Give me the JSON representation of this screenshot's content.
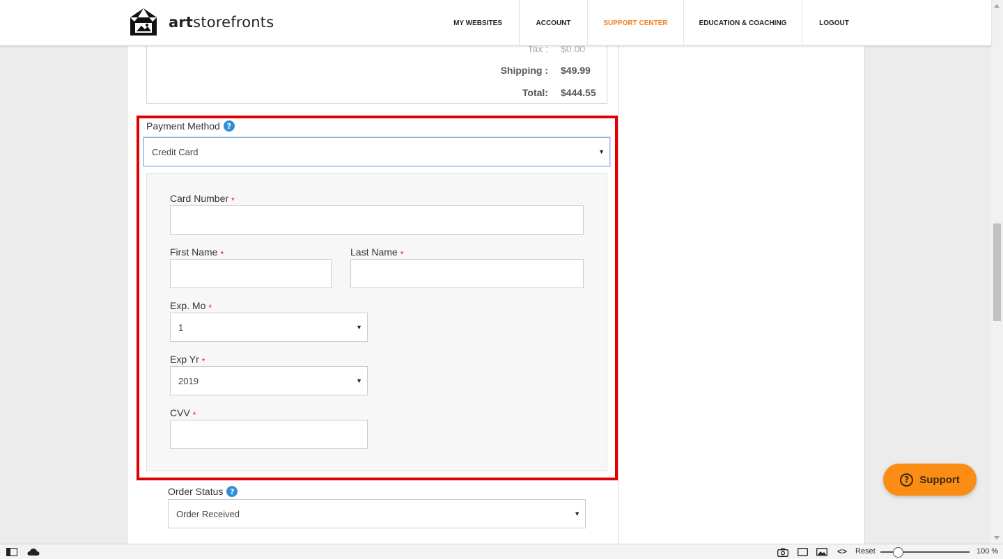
{
  "brand": {
    "name_bold": "art",
    "name_rest": "storefronts"
  },
  "nav": {
    "items": [
      {
        "label": "MY WEBSITES"
      },
      {
        "label": "ACCOUNT"
      },
      {
        "label": "SUPPORT CENTER"
      },
      {
        "label": "EDUCATION & COACHING"
      },
      {
        "label": "LOGOUT"
      }
    ],
    "active_color": "#f07d1d"
  },
  "totals": {
    "tax_label": "Tax :",
    "tax_value": "$0.00",
    "shipping_label": "Shipping :",
    "shipping_value": "$49.99",
    "total_label": "Total:",
    "total_value": "$444.55"
  },
  "payment": {
    "label": "Payment Method",
    "method_value": "Credit Card",
    "card_number_label": "Card Number",
    "first_name_label": "First Name",
    "last_name_label": "Last Name",
    "exp_mo_label": "Exp. Mo",
    "exp_mo_value": "1",
    "exp_yr_label": "Exp Yr",
    "exp_yr_value": "2019",
    "cvv_label": "CVV",
    "required_mark": "*"
  },
  "order_status": {
    "label": "Order Status",
    "value": "Order Received"
  },
  "support": {
    "label": "Support"
  },
  "statusbar": {
    "reset_label": "Reset",
    "zoom": "100 %"
  },
  "icons": {
    "help": "question-mark-circle-icon",
    "caret": "caret-down-icon"
  },
  "colors": {
    "highlight": "#e00000",
    "help_blue": "#2f8fd8",
    "support_orange": "#fb8c14",
    "required_red": "#e02020"
  }
}
